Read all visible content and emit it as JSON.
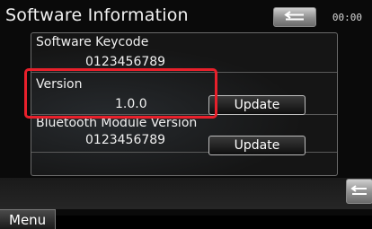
{
  "header": {
    "title": "Software Information",
    "clock": "00:00"
  },
  "panel": {
    "rows": [
      {
        "label": "Software Keycode",
        "value": "0123456789"
      },
      {
        "label": "Version",
        "value": "1.0.0",
        "button": "Update"
      },
      {
        "label": "Bluetooth Module Version",
        "value": "0123456789",
        "button": "Update"
      }
    ]
  },
  "footer": {
    "menu_label": "Menu"
  },
  "colors": {
    "highlight": "#e8202b",
    "background": "#0a0a0a"
  },
  "icons": {
    "back": "back-arrow-icon",
    "return": "return-icon"
  }
}
